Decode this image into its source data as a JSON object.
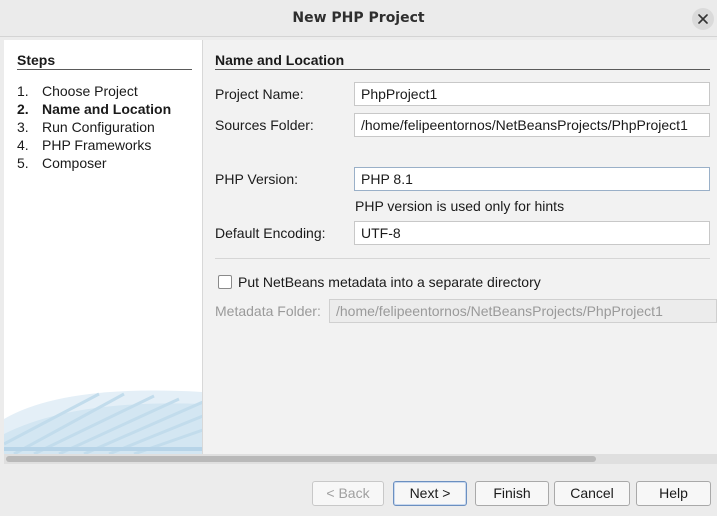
{
  "window": {
    "title": "New PHP Project",
    "close_icon": "close-icon"
  },
  "steps": {
    "heading": "Steps",
    "items": [
      {
        "num": "1.",
        "label": "Choose Project"
      },
      {
        "num": "2.",
        "label": "Name and Location"
      },
      {
        "num": "3.",
        "label": "Run Configuration"
      },
      {
        "num": "4.",
        "label": "PHP Frameworks"
      },
      {
        "num": "5.",
        "label": "Composer"
      }
    ],
    "current_index": 1
  },
  "panel": {
    "heading": "Name and Location",
    "project_name": {
      "label": "Project Name:",
      "value": "PhpProject1"
    },
    "sources_folder": {
      "label": "Sources Folder:",
      "value": "/home/felipeentornos/NetBeansProjects/PhpProject1"
    },
    "php_version": {
      "label": "PHP Version:",
      "value": "PHP 8.1",
      "hint": "PHP version is used only for hints"
    },
    "default_encoding": {
      "label": "Default Encoding:",
      "value": "UTF-8"
    },
    "separate_metadata": {
      "label": "Put NetBeans metadata into a separate directory",
      "checked": false
    },
    "metadata_folder": {
      "label": "Metadata Folder:",
      "value": "/home/felipeentornos/NetBeansProjects/PhpProject1"
    }
  },
  "buttons": {
    "back": "< Back",
    "next": "Next >",
    "finish": "Finish",
    "cancel": "Cancel",
    "help": "Help"
  },
  "colors": {
    "accent": "#6b8fc0",
    "decoration": "#cfe3f0"
  }
}
